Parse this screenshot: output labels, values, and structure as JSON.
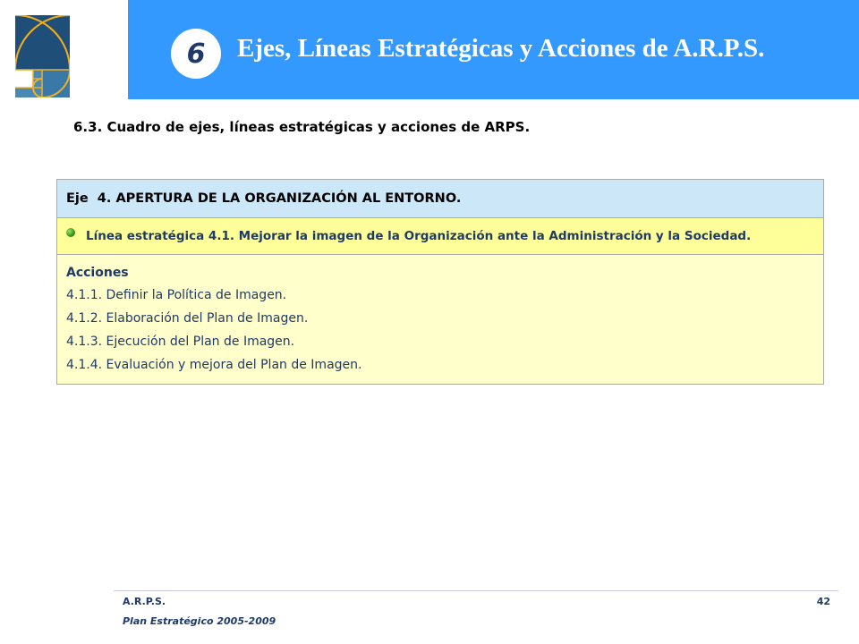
{
  "header": {
    "chapter_number": "6",
    "title": "Ejes, Líneas Estratégicas y Acciones de A.R.P.S."
  },
  "section": {
    "heading": "6.3. Cuadro de ejes, líneas estratégicas y acciones de ARPS."
  },
  "table": {
    "axis": "Eje  4. APERTURA DE LA ORGANIZACIÓN AL ENTORNO.",
    "line": "Línea estratégica 4.1. Mejorar la imagen de la Organización ante la Administración y la Sociedad.",
    "actions_title": "Acciones",
    "actions": [
      "4.1.1. Definir la Política de Imagen.",
      "4.1.2. Elaboración del Plan de Imagen.",
      "4.1.3. Ejecución del Plan de Imagen.",
      "4.1.4. Evaluación y mejora del Plan de Imagen."
    ]
  },
  "footer": {
    "org": "A.R.P.S.",
    "plan": "Plan Estratégico 2005-2009",
    "page": "42"
  },
  "colors": {
    "header_band": "#3399ff",
    "axis_row": "#cce8f8",
    "line_row": "#ffff99",
    "actions_row": "#ffffcc",
    "text_navy": "#1f3a66"
  }
}
